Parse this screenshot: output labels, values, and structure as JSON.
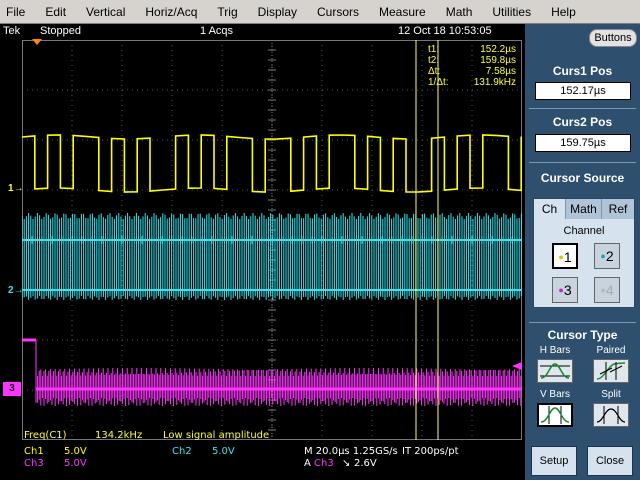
{
  "menu": [
    "File",
    "Edit",
    "Vertical",
    "Horiz/Acq",
    "Trig",
    "Display",
    "Cursors",
    "Measure",
    "Math",
    "Utilities",
    "Help"
  ],
  "status": {
    "brand": "Tek",
    "state": "Stopped",
    "acqs": "1 Acqs",
    "datetime": "12 Oct 18 10:53:05"
  },
  "cursor_readout": {
    "t1_label": "t1:",
    "t1_value": "152.2µs",
    "t2_label": "t2:",
    "t2_value": "159.8µs",
    "dt_label": "Δt:",
    "dt_value": "7.58µs",
    "inv_label": "1/Δt:",
    "inv_value": "131.9kHz"
  },
  "measurement": {
    "label": "Freq(C1)",
    "value": "134.2kHz",
    "note": "Low signal amplitude"
  },
  "bottom": {
    "ch1_label": "Ch1",
    "ch1_value": "5.0V",
    "ch2_label": "Ch2",
    "ch2_value": "5.0V",
    "ch3_label": "Ch3",
    "ch3_value": "5.0V",
    "timebase": "M 20.0µs 1.25GS/s",
    "resolution": "IT 200ps/pt",
    "trigger_prefix": "A",
    "trigger_channel": "Ch3",
    "trigger_slope": "↘",
    "trigger_level": "2.6V"
  },
  "markers": {
    "ch1": "1",
    "ch2": "2",
    "ch3": "3"
  },
  "panel": {
    "buttons_label": "Buttons",
    "curs1_title": "Curs1 Pos",
    "curs1_value": "152.17µs",
    "curs2_title": "Curs2 Pos",
    "curs2_value": "159.75µs",
    "source_title": "Cursor Source",
    "tabs": [
      "Ch",
      "Math",
      "Ref"
    ],
    "channel_label": "Channel",
    "channels": [
      "1",
      "2",
      "3",
      "4"
    ],
    "type_title": "Cursor Type",
    "hbars": "H Bars",
    "paired": "Paired",
    "vbars": "V Bars",
    "split": "Split",
    "setup": "Setup",
    "close": "Close"
  },
  "colors": {
    "ch1": "#ffff00",
    "ch2": "#33e6f0",
    "ch3": "#ff33ff",
    "cursor": "#ffff66",
    "panel": "#2e4f6e"
  }
}
